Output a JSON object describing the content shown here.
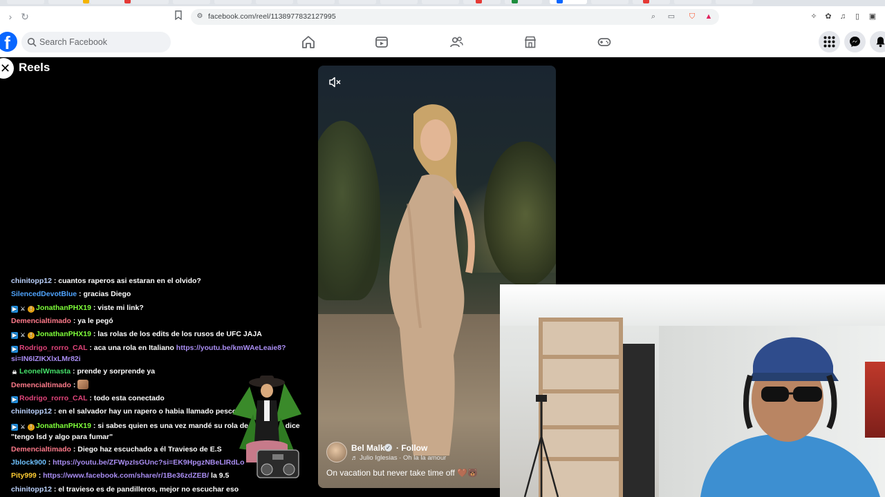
{
  "browser": {
    "url": "facebook.com/reel/1138977832127995"
  },
  "facebook": {
    "logo": "f",
    "search_placeholder": "Search Facebook",
    "nav_icons": [
      "home-icon",
      "video-icon",
      "friends-icon",
      "marketplace-icon",
      "gaming-icon"
    ],
    "right_icons": [
      "menu-grid-icon",
      "messenger-icon",
      "notifications-icon"
    ],
    "brand_color": "#0866ff"
  },
  "reels": {
    "title": "Reels",
    "close_symbol": "✕",
    "author": "Bel Malk",
    "follow_label": "· Follow",
    "music": "♬ Julio Iglesias · Oh la la amour",
    "caption": "On vacation but never take time off 🤎🐻"
  },
  "chat": [
    {
      "badges": [],
      "user": "chinitopp12",
      "color": "#bcd3ff",
      "text": " : cuantos raperos asi estaran en el olvido?"
    },
    {
      "badges": [],
      "user": "SilencedDevotBlue",
      "color": "#4fa4ff",
      "text": " : gracias Diego"
    },
    {
      "badges": [
        "blue",
        "sword",
        "gold"
      ],
      "user": "JonathanPHX19",
      "color": "#7fff3a",
      "text": " : viste mi link?"
    },
    {
      "badges": [],
      "user": "Demencialtimado",
      "color": "#ff7a8a",
      "text": " : ya le pegó"
    },
    {
      "badges": [
        "blue",
        "sword",
        "gold"
      ],
      "user": "JonathanPHX19",
      "color": "#7fff3a",
      "text": " : las rolas de los edits de los rusos de UFC JAJA"
    },
    {
      "badges": [
        "blue"
      ],
      "user": "Rodrigo_rorro_CAL",
      "color": "#e0447a",
      "text": " : aca una rola en Italiano ",
      "link": "https://youtu.be/kmWAeLeaie8?si=IN6IZIKXlxLMr82i",
      "wrap": true
    },
    {
      "badges": [
        "skull"
      ],
      "user": "LeonelWmasta",
      "color": "#45e06a",
      "text": " : prende y sorprende ya"
    },
    {
      "badges": [],
      "user": "Demencialtimado",
      "color": "#ff7a8a",
      "text": " : ",
      "emote": true
    },
    {
      "badges": [
        "blue"
      ],
      "user": "Rodrigo_rorro_CAL",
      "color": "#e0447a",
      "text": " : todo esta conectado"
    },
    {
      "badges": [],
      "user": "chinitopp12",
      "color": "#bcd3ff",
      "text": " : en el salvador hay un rapero o habia llamado pescozada"
    },
    {
      "badges": [
        "blue",
        "sword",
        "gold"
      ],
      "user": "JonathanPHX19",
      "color": "#7fff3a",
      "text": " : si sabes quien es una vez mandé su rola de la playa q dice \"tengo lsd y algo para fumar\"",
      "wrap": true
    },
    {
      "badges": [],
      "user": "Demencialtimado",
      "color": "#ff7a8a",
      "text": " : Diego haz escuchado a él Travieso de E.S"
    },
    {
      "badges": [],
      "user": "Jblock900",
      "color": "#6ec1ff",
      "text": " : ",
      "link": "https://youtu.be/ZFWpzIsGUnc?si=EK9HpgzNBeLIRdLo"
    },
    {
      "badges": [],
      "user": "Pity999",
      "color": "#ffcc33",
      "text": " : ",
      "link": "https://www.facebook.com/share/r/1Be36zdZEB/",
      "after": " la 9.5"
    },
    {
      "badges": [],
      "user": "chinitopp12",
      "color": "#bcd3ff",
      "text": " : el travieso es de pandilleros, mejor no escuchar eso"
    }
  ]
}
